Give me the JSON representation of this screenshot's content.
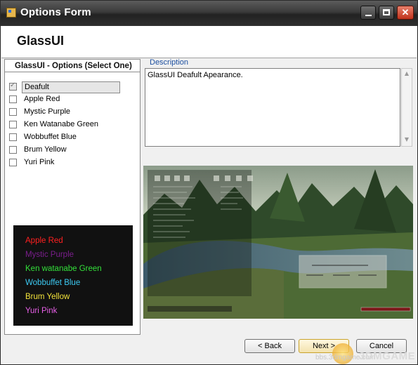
{
  "window": {
    "title": "Options Form"
  },
  "header": {
    "title": "GlassUI"
  },
  "options": {
    "title": "GlassUI - Options (Select One)",
    "items": [
      {
        "label": "Deafult",
        "checked": true
      },
      {
        "label": "Apple Red",
        "checked": false
      },
      {
        "label": "Mystic Purple",
        "checked": false
      },
      {
        "label": "Ken Watanabe Green",
        "checked": false
      },
      {
        "label": "Wobbuffet Blue",
        "checked": false
      },
      {
        "label": "Brum Yellow",
        "checked": false
      },
      {
        "label": "Yuri Pink",
        "checked": false
      }
    ]
  },
  "legend": {
    "items": [
      {
        "label": "Apple Red",
        "color": "#ff2020"
      },
      {
        "label": "Mystic Purple",
        "color": "#7a1e8c"
      },
      {
        "label": "Ken watanabe Green",
        "color": "#33e03a"
      },
      {
        "label": "Wobbuffet Blue",
        "color": "#3cc9f2"
      },
      {
        "label": "Brum Yellow",
        "color": "#f2e23a"
      },
      {
        "label": "Yuri Pink",
        "color": "#e85fe8"
      }
    ]
  },
  "description": {
    "label": "Description",
    "text": "GlassUI Deafult Apearance."
  },
  "buttons": {
    "back": "< Back",
    "next": "Next >",
    "cancel": "Cancel"
  },
  "watermark": {
    "brand": "3DMGAME",
    "url": "bbs.3dmgame.com"
  }
}
